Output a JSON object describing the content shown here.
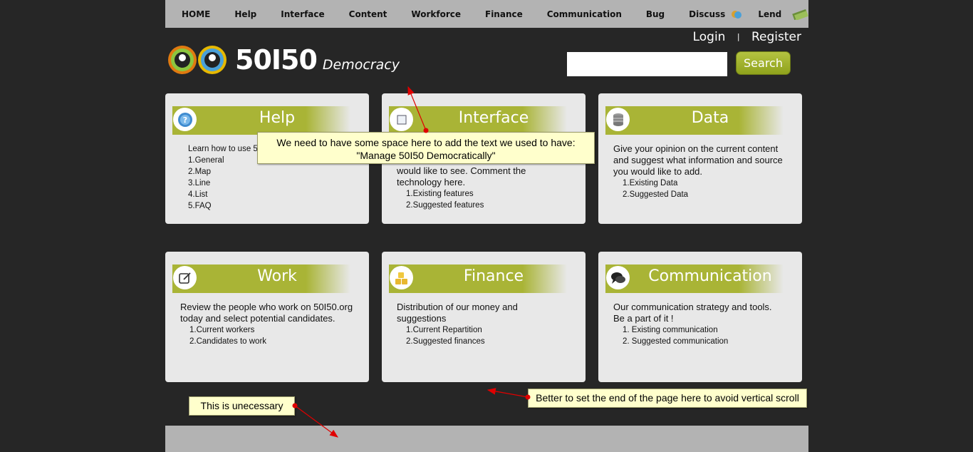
{
  "nav": {
    "items": [
      "HOME",
      "Help",
      "Interface",
      "Content",
      "Workforce",
      "Finance",
      "Communication",
      "Bug",
      "Discuss",
      "Lend"
    ]
  },
  "header": {
    "login": "Login",
    "separator": "|",
    "register": "Register",
    "logo_number": "50I50",
    "logo_subtitle": "Democracy",
    "search_button": "Search"
  },
  "cards": [
    {
      "title": "Help",
      "icon": "question-icon",
      "intro": "Learn how to use 5",
      "items": [
        "1.General",
        "2.Map",
        "3.Line",
        "4.List",
        "5.FAQ"
      ]
    },
    {
      "title": "Interface",
      "icon": "window-icon",
      "intro": "would like to see. Comment the technology here.",
      "items": [
        "1.Existing features",
        "2.Suggested features"
      ]
    },
    {
      "title": "Data",
      "icon": "database-icon",
      "intro": "Give your opinion on the current content and suggest what information and source you would like to add.",
      "items": [
        "1.Existing Data",
        "2.Suggested Data"
      ]
    },
    {
      "title": "Work",
      "icon": "edit-icon",
      "intro": "Review the people who work on 50I50.org today and select potential candidates.",
      "items": [
        "1.Current workers",
        "2.Candidates to work"
      ]
    },
    {
      "title": "Finance",
      "icon": "coins-icon",
      "intro": "Distribution of our money and suggestions",
      "items": [
        "1.Current Repartition",
        "2.Suggested finances"
      ]
    },
    {
      "title": "Communication",
      "icon": "chat-icon",
      "intro": "Our communication strategy and tools. Be a part of it !",
      "items": [
        "1. Existing communication",
        "2. Suggested communication"
      ]
    }
  ],
  "annotations": {
    "top_line1": "We need to have some space here to add the text we used to have:",
    "top_line2": "\"Manage 50I50 Democratically\"",
    "unnecessary": "This is unecessary",
    "end_page": "Better to set the end of the page here to avoid vertical scroll"
  },
  "colors": {
    "background": "#262626",
    "nav_bar": "#b3b3b3",
    "accent_green": "#a9b436",
    "card_bg": "#e8e8e8",
    "note_bg": "#ffffcc",
    "arrow_red": "#e00000"
  }
}
